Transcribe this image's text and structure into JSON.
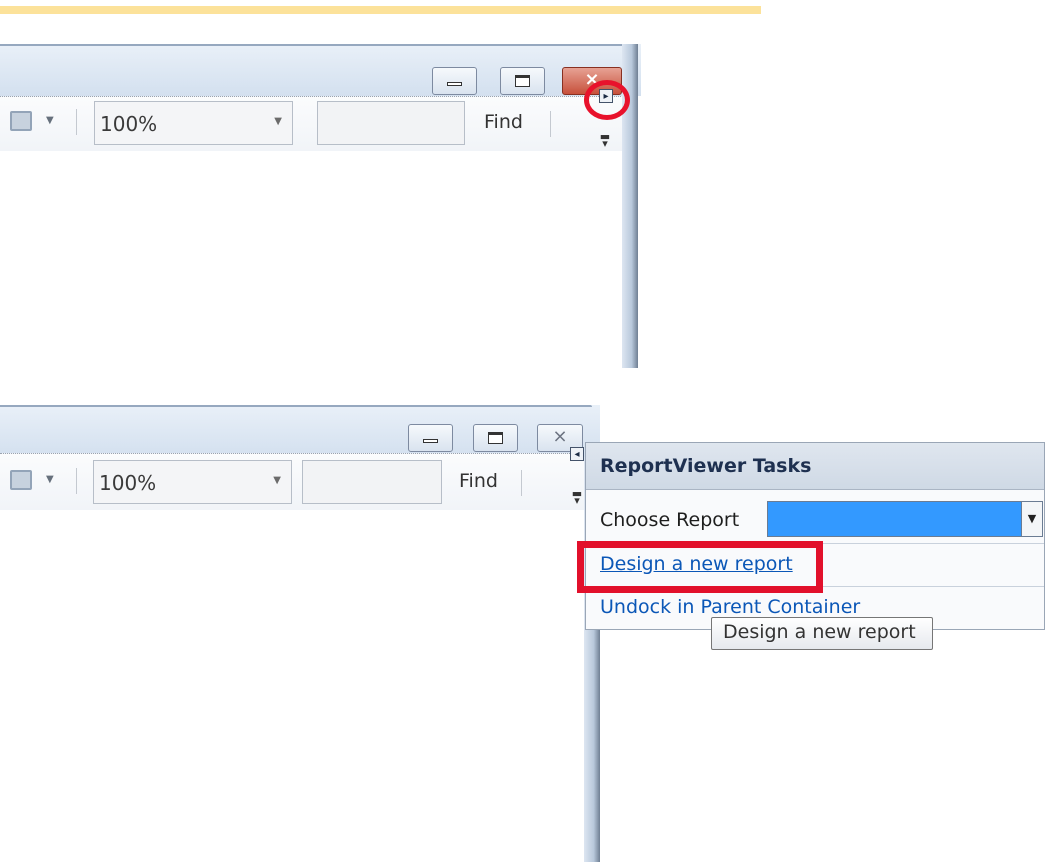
{
  "toolbar": {
    "zoom_value": "100%",
    "find_label": "Find"
  },
  "window_controls": {
    "close_glyph": "⨯"
  },
  "tasks_panel": {
    "title": "ReportViewer Tasks",
    "choose_report_label": "Choose Report",
    "choose_report_value": "",
    "design_new_report_link": "Design a new report",
    "undock_link": "Undock in Parent Container",
    "smart_tag_glyph": "◂"
  },
  "tooltip": {
    "text": "Design a new report"
  },
  "icons": {
    "save": "save-icon",
    "dropdown": "chevron-down-icon",
    "overflow": "toolbar-overflow-icon",
    "smart_tag": "smart-tag-icon"
  },
  "colors": {
    "highlight_stripe": "#fce29a",
    "annotation_red": "#e8122c",
    "selection_blue": "#3399ff",
    "link_blue": "#0b57b7"
  }
}
